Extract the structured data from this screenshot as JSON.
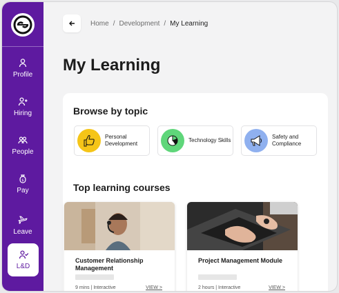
{
  "sidebar": {
    "items": [
      {
        "label": "Profile",
        "icon": "person-icon"
      },
      {
        "label": "Hiring",
        "icon": "add-person-icon"
      },
      {
        "label": "People",
        "icon": "people-icon"
      },
      {
        "label": "Pay",
        "icon": "money-bag-icon"
      },
      {
        "label": "Leave",
        "icon": "plane-icon"
      },
      {
        "label": "L&D",
        "icon": "learning-icon",
        "active": true
      }
    ]
  },
  "breadcrumb": {
    "items": [
      "Home",
      "Development"
    ],
    "current": "My Learning",
    "separator": "/"
  },
  "page": {
    "title": "My Learning"
  },
  "topics": {
    "title": "Browse by topic",
    "items": [
      {
        "label": "Personal Development",
        "icon": "thumbs-up-icon",
        "color": "#f5c518"
      },
      {
        "label": "Technology Skills",
        "icon": "chart-icon",
        "color": "#5fd67a"
      },
      {
        "label": "Safety and Compliance",
        "icon": "megaphone-icon",
        "color": "#8fb0ef"
      }
    ]
  },
  "courses": {
    "title": "Top learning courses",
    "items": [
      {
        "title": "Customer Relationship Management",
        "meta": "9 mins | Interactive",
        "view": "VIEW >"
      },
      {
        "title": "Project Management Module",
        "meta": "2 hours | Interactive",
        "view": "VIEW >"
      }
    ]
  },
  "colors": {
    "brand": "#5e1aa0",
    "background": "#f3f3f4"
  }
}
